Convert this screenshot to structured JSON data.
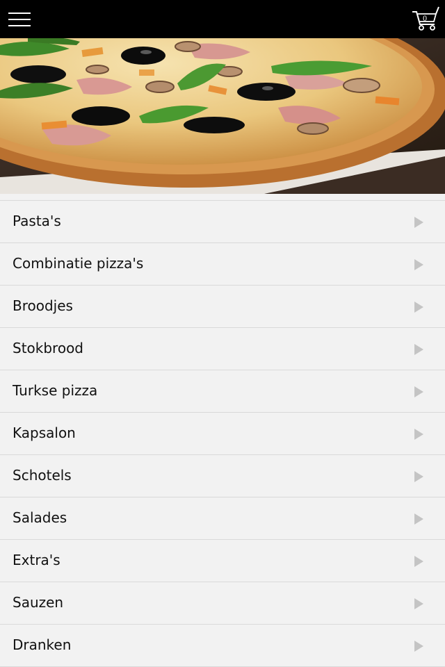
{
  "header": {
    "menu_icon": "hamburger-menu-icon",
    "cart_icon": "shopping-cart-icon",
    "cart_count": "0"
  },
  "hero": {
    "image": "pizza-photo"
  },
  "menu": {
    "items": [
      {
        "label": "Pasta's"
      },
      {
        "label": "Combinatie pizza's"
      },
      {
        "label": "Broodjes"
      },
      {
        "label": "Stokbrood"
      },
      {
        "label": "Turkse pizza"
      },
      {
        "label": "Kapsalon"
      },
      {
        "label": "Schotels"
      },
      {
        "label": "Salades"
      },
      {
        "label": "Extra's"
      },
      {
        "label": "Sauzen"
      },
      {
        "label": "Dranken"
      }
    ],
    "arrow_icon": "chevron-right-icon"
  },
  "colors": {
    "topbar": "#000000",
    "list_background": "#f2f2f2",
    "divider": "#d9d9d9",
    "arrow": "#c4c4c4"
  }
}
